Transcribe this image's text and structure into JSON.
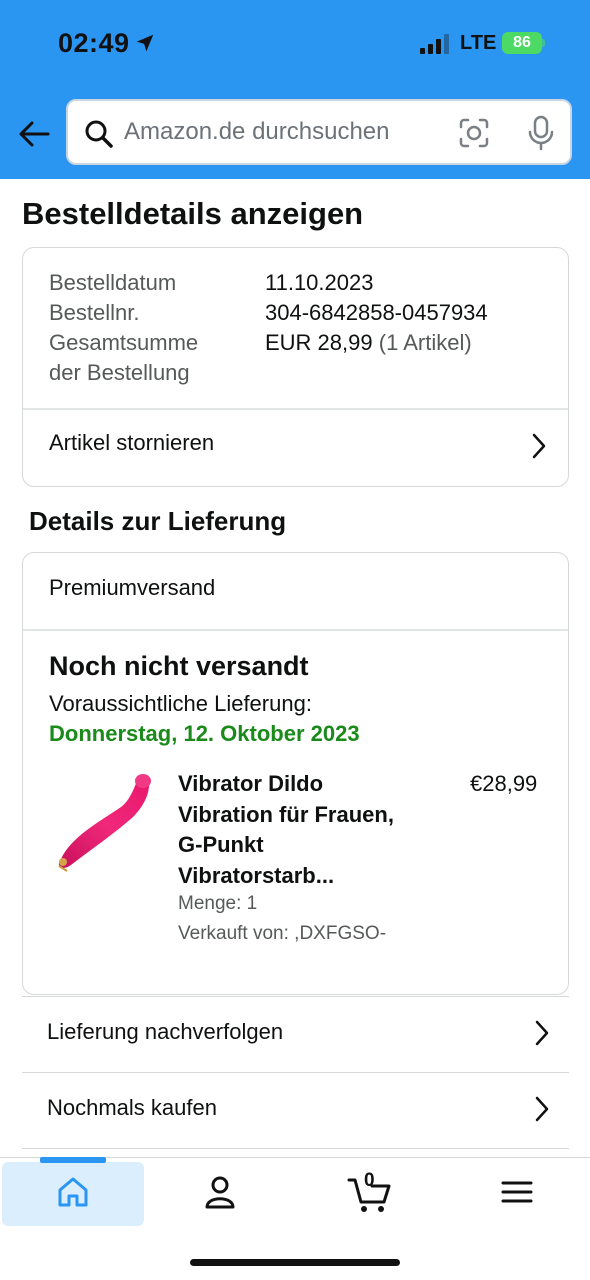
{
  "status_bar": {
    "time": "02:49",
    "network": "LTE",
    "battery": "86"
  },
  "search": {
    "placeholder": "Amazon.de durchsuchen"
  },
  "page": {
    "title": "Bestelldetails anzeigen"
  },
  "order_summary": {
    "date_label": "Bestelldatum",
    "date_value": "11.10.2023",
    "number_label": "Bestellnr.",
    "number_value": "304-6842858-0457934",
    "total_label_line1": "Gesamtsumme",
    "total_label_line2": "der Bestellung",
    "total_value": "EUR 28,99",
    "total_items": "(1 Artikel)",
    "cancel_label": "Artikel stornieren"
  },
  "delivery": {
    "section_title": "Details zur Lieferung",
    "shipping_type": "Premiumversand",
    "status": "Noch nicht versandt",
    "eta_label": "Voraussichtliche Lieferung:",
    "eta_date": "Donnerstag, 12. Oktober 2023",
    "item": {
      "title_lines": [
        "Vibrator Dildo",
        "Vibration für Frauen,",
        "G-Punkt",
        "Vibratorstarb..."
      ],
      "price": "€28,99",
      "quantity": "Menge: 1",
      "seller": "Verkauft von: ,DXFGSO-"
    },
    "eta_color": "#1a8a1a"
  },
  "actions": {
    "track": "Lieferung nachverfolgen",
    "buy_again": "Nochmals kaufen"
  },
  "tabbar": {
    "cart_count": "0",
    "tabs": [
      "home-icon",
      "account-icon",
      "cart-icon",
      "menu-icon"
    ],
    "accent": "#2b95f2"
  }
}
